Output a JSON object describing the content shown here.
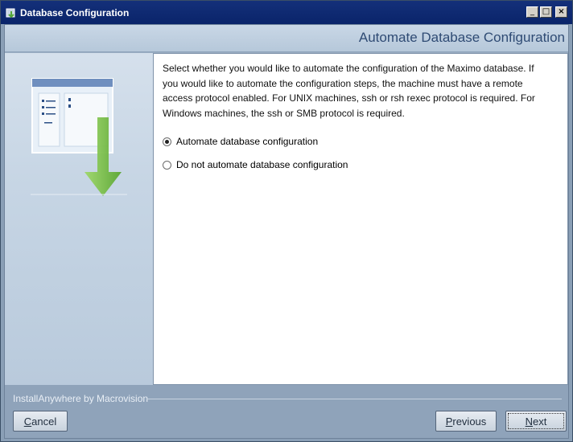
{
  "window": {
    "title": "Database Configuration",
    "controls": {
      "minimize": "_",
      "maximize": "□",
      "close": "×"
    }
  },
  "header": {
    "title": "Automate Database Configuration"
  },
  "main": {
    "description": "Select whether you would like to automate the configuration of the Maximo database. If you would like to automate the configuration steps, the machine must have a remote access protocol enabled. For UNIX machines, ssh or rsh rexec protocol is required. For Windows machines, the ssh or SMB protocol is required.",
    "options": [
      {
        "label": "Automate database configuration",
        "selected": true
      },
      {
        "label": "Do not automate database configuration",
        "selected": false
      }
    ]
  },
  "footer": {
    "brand": "InstallAnywhere by Macrovision",
    "cancel": {
      "first": "C",
      "rest": "ancel"
    },
    "previous": {
      "first": "P",
      "rest": "revious"
    },
    "next": {
      "first": "N",
      "rest": "ext"
    }
  },
  "colors": {
    "titlebar": "#0a246a",
    "header_text": "#2f4b74",
    "frame": "#9aaec3",
    "arrow": "#7dc04a"
  },
  "icons": [
    "installer-app-icon",
    "database-setup-graphic"
  ]
}
